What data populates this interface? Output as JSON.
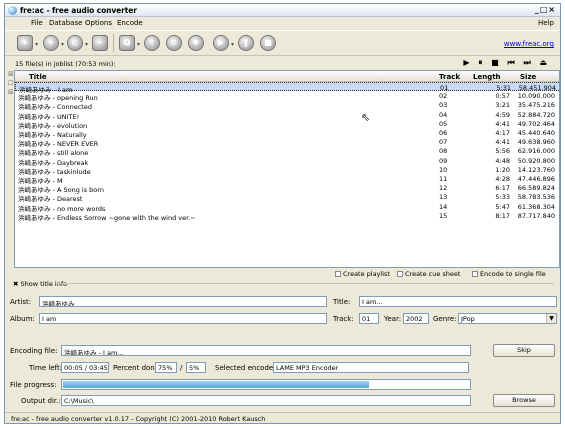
{
  "window": {
    "title": "fre:ac - free audio converter",
    "controls": "_□×"
  },
  "menu": {
    "items": [
      "File",
      "Database",
      "Options",
      "Encode"
    ],
    "help": "Help"
  },
  "toolbar": {
    "website": "www.freac.org",
    "icons": [
      "add-files",
      "add-folder",
      "add-disc",
      "cddb-query",
      "cddb-submit",
      "configure",
      "encoder-config",
      "start-encoding",
      "pause-encoding",
      "stop-encoding"
    ]
  },
  "joblist": {
    "status": "15 file(s) in joblist (70:53 min):",
    "player": "▶ ⏸ ■ ⏮ ⏭ ⏏",
    "columns": {
      "title": "Title",
      "track": "Track",
      "length": "Length",
      "size": "Size"
    },
    "rows": [
      {
        "title": "浜崎あゆみ - I am",
        "track": "01",
        "length": "5:31",
        "size": "58.451.904",
        "selected": true
      },
      {
        "title": "浜崎あゆみ - opening Run",
        "track": "02",
        "length": "0:57",
        "size": "10.090.000"
      },
      {
        "title": "浜崎あゆみ - Connected",
        "track": "03",
        "length": "3:21",
        "size": "35.475.216"
      },
      {
        "title": "浜崎あゆみ - UNITE!",
        "track": "04",
        "length": "4:59",
        "size": "52.884.720"
      },
      {
        "title": "浜崎あゆみ - evolution",
        "track": "05",
        "length": "4:41",
        "size": "49.702.464"
      },
      {
        "title": "浜崎あゆみ - Naturally",
        "track": "06",
        "length": "4:17",
        "size": "45.440.640"
      },
      {
        "title": "浜崎あゆみ - NEVER EVER",
        "track": "07",
        "length": "4:41",
        "size": "49.638.960"
      },
      {
        "title": "浜崎あゆみ - still alone",
        "track": "08",
        "length": "5:56",
        "size": "62.916.000"
      },
      {
        "title": "浜崎あゆみ - Daybreak",
        "track": "09",
        "length": "4:48",
        "size": "50.920.800"
      },
      {
        "title": "浜崎あゆみ - taskinlude",
        "track": "10",
        "length": "1:20",
        "size": "14.123.760"
      },
      {
        "title": "浜崎あゆみ - M",
        "track": "11",
        "length": "4:28",
        "size": "47.446.896"
      },
      {
        "title": "浜崎あゆみ - A Song is born",
        "track": "12",
        "length": "6:17",
        "size": "66.589.824"
      },
      {
        "title": "浜崎あゆみ - Dearest",
        "track": "13",
        "length": "5:33",
        "size": "58.783.536"
      },
      {
        "title": "浜崎あゆみ - no more words",
        "track": "14",
        "length": "5:47",
        "size": "61.368.304"
      },
      {
        "title": "浜崎あゆみ - Endless Sorrow ~gone with the wind ver.~",
        "track": "15",
        "length": "8:17",
        "size": "87.717.840"
      }
    ]
  },
  "options": {
    "create_playlist": "Create playlist",
    "create_cue": "Create cue sheet",
    "single_file": "Encode to single file"
  },
  "titleinfo": {
    "toggle": "✖ Show title info",
    "artist_label": "Artist:",
    "artist": "浜崎あゆみ",
    "title_label": "Title:",
    "title": "I am...",
    "album_label": "Album:",
    "album": "I am",
    "track_label": "Track:",
    "track": "01",
    "year_label": "Year:",
    "year": "2002",
    "genre_label": "Genre:",
    "genre": "JPop"
  },
  "encoding": {
    "file_label": "Encoding file:",
    "file": "浜崎あゆみ - I am...",
    "skip": "Skip",
    "time_label": "Time left:",
    "time": "00:05 / 03:45",
    "percent_label": "Percent done:",
    "percent": "75%",
    "percent_total": "5%",
    "encoder_label": "Selected encoder:",
    "encoder": "LAME MP3 Encoder",
    "progress_label": "File progress:",
    "file_progress": 0.75,
    "total_progress": 0.05,
    "output_label": "Output dir.:",
    "output": "C:\\Music\\",
    "browse": "Browse"
  },
  "status": "fre:ac - free audio converter v1.0.17 - Copyright (C) 2001-2010 Robert Kausch"
}
